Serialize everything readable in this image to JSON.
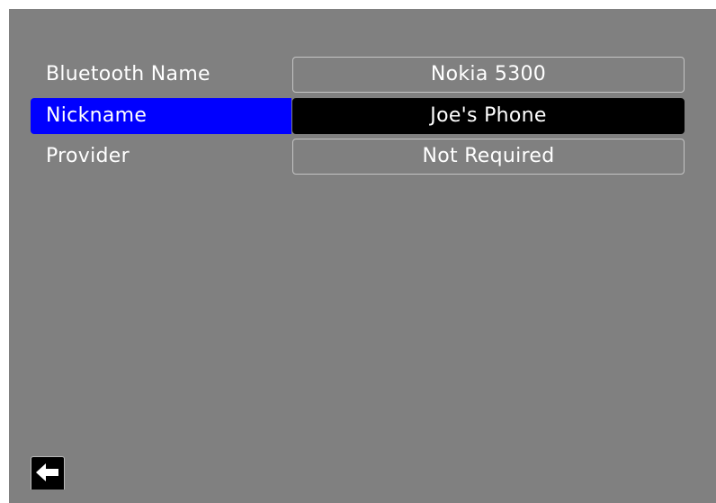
{
  "settings": {
    "rows": [
      {
        "label": "Bluetooth Name",
        "value": "Nokia 5300",
        "selected": false
      },
      {
        "label": "Nickname",
        "value": "Joe's Phone",
        "selected": true
      },
      {
        "label": "Provider",
        "value": "Not Required",
        "selected": false
      }
    ]
  },
  "footer": {
    "back_icon": "left-arrow-icon"
  },
  "colors": {
    "background": "#808080",
    "selected_label_bg": "#0000ff",
    "selected_value_bg": "#000000",
    "text": "#ffffff"
  }
}
